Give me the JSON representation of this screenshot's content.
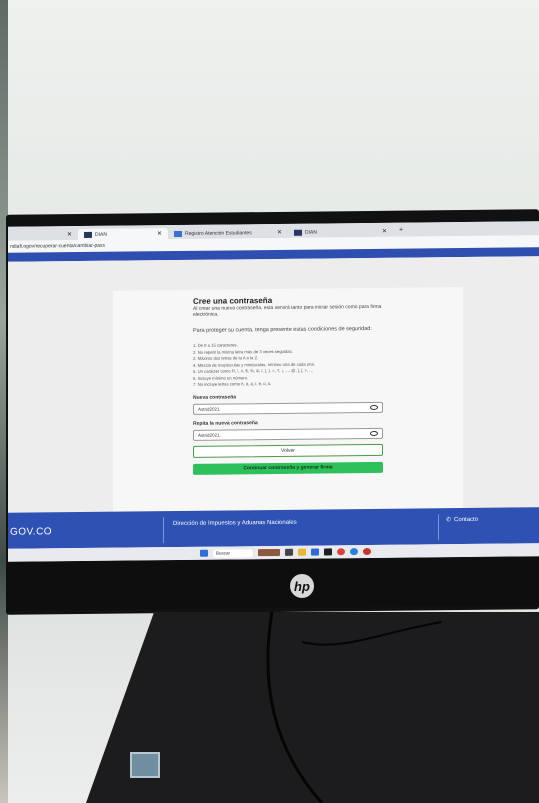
{
  "browser": {
    "tabs": [
      {
        "label": "DIAN",
        "active": true
      },
      {
        "label": "Registro Atención Estudiantes",
        "active": false
      },
      {
        "label": "DIAN",
        "active": false
      }
    ],
    "new_tab": "+",
    "url": "ndiafi.ogov/recuperar-cuenta/cambiar-pass"
  },
  "form": {
    "title": "Cree una contraseña",
    "intro": "Al crear una nueva contraseña, esta servirá tanto para iniciar sesión como para firma electrónica.",
    "conditions_intro": "Para proteger su cuenta, tenga presente estas condiciones de seguridad:",
    "rules": [
      "1. De 8 a 15 caracteres.",
      "2. No repetir la misma letra más de 3 veces seguidas.",
      "3. Máximo dos letras de la A a la Z.",
      "4. Mezcla de mayúsculas y minúsculas, mínimo una de cada una.",
      "5. Un carácter como R, !, #, $, %, &, /, (, ), =, ?, ¡, ..., @, ], [, +, ...",
      "6. Incluye mínimo un número.",
      "7. No incluye letras como ñ, ó, á, í, é, ú, ü."
    ],
    "new_password_label": "Nueva contraseña",
    "new_password_value": "Astrid2021.",
    "repeat_password_label": "Repita la nueva contraseña",
    "repeat_password_value": "Astrid2021.",
    "back_button": "Volver",
    "submit_button": "Continuar contraseña y generar firma"
  },
  "footer": {
    "brand": "GOV.CO",
    "org": "Dirección de Impuestos y Aduanas Nacionales",
    "contact": "Contacto"
  },
  "taskbar": {
    "search": "Buscar"
  },
  "monitor": {
    "logo": "hp"
  },
  "colors": {
    "header_blue": "#2f4fb0",
    "submit_green": "#2ec05a",
    "footer_blue": "#2e51b3"
  }
}
